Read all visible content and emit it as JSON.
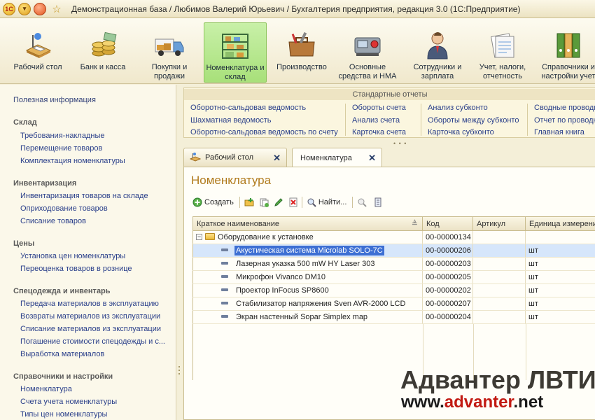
{
  "window": {
    "title": "Демонстрационная база / Любимов Валерий Юрьевич / Бухгалтерия предприятия, редакция 3.0  (1С:Предприятие)",
    "logo_text": "1С"
  },
  "sections": [
    {
      "label": "Рабочий стол",
      "icon": "desk-icon"
    },
    {
      "label": "Банк и касса",
      "icon": "coins-icon"
    },
    {
      "label": "Покупки и продажи",
      "icon": "truck-icon"
    },
    {
      "label": "Номенклатура и склад",
      "icon": "warehouse-icon",
      "active": true
    },
    {
      "label": "Производство",
      "icon": "toolbox-icon"
    },
    {
      "label": "Основные средства и НМА",
      "icon": "machine-icon"
    },
    {
      "label": "Сотрудники и зарплата",
      "icon": "employee-icon"
    },
    {
      "label": "Учет, налоги, отчетность",
      "icon": "documents-icon"
    },
    {
      "label": "Справочники и настройки учет",
      "icon": "binders-icon"
    }
  ],
  "sidebar": {
    "info": "Полезная информация",
    "groups": [
      {
        "title": "Склад",
        "items": [
          "Требования-накладные",
          "Перемещение товаров",
          "Комплектация номенклатуры"
        ]
      },
      {
        "title": "Инвентаризация",
        "items": [
          "Инвентаризация товаров на складе",
          "Оприходование товаров",
          "Списание товаров"
        ]
      },
      {
        "title": "Цены",
        "items": [
          "Установка цен номенклатуры",
          "Переоценка товаров в рознице"
        ]
      },
      {
        "title": "Спецодежда и инвентарь",
        "items": [
          "Передача материалов в эксплуатацию",
          "Возвраты материалов из эксплуатации",
          "Списание материалов из эксплуатации",
          "Погашение стоимости спецодежды и с...",
          "Выработка материалов"
        ]
      },
      {
        "title": "Справочники и настройки",
        "items": [
          "Номенклатура",
          "Счета учета номенклатуры",
          "Типы цен номенклатуры"
        ]
      }
    ]
  },
  "reports": {
    "title": "Стандартные отчеты",
    "columns": [
      [
        "Оборотно-сальдовая ведомость",
        "Шахматная ведомость",
        "Оборотно-сальдовая ведомость по счету"
      ],
      [
        "Обороты счета",
        "Анализ счета",
        "Карточка счета"
      ],
      [
        "Анализ субконто",
        "Обороты между субконто",
        "Карточка субконто"
      ],
      [
        "Сводные проводки",
        "Отчет по проводкам",
        "Главная книга"
      ]
    ]
  },
  "tabs": [
    {
      "label": "Рабочий стол"
    },
    {
      "label": "Номенклатура"
    }
  ],
  "form": {
    "title": "Номенклатура",
    "create_label": "Создать",
    "find_label": "Найти..."
  },
  "table": {
    "columns": [
      "Краткое наименование",
      "Код",
      "Артикул",
      "Единица измерения"
    ],
    "rows": [
      {
        "type": "folder",
        "name": "Оборудование к установке",
        "code": "00-00000134",
        "article": "",
        "unit": ""
      },
      {
        "type": "item",
        "name": "Акустическая система Microlab SOLO-7C",
        "code": "00-00000206",
        "article": "",
        "unit": "шт",
        "selected": true
      },
      {
        "type": "item",
        "name": "Лазерная указка 500 mW HY Laser 303",
        "code": "00-00000203",
        "article": "",
        "unit": "шт"
      },
      {
        "type": "item",
        "name": "Микрофон Vivanco DM10",
        "code": "00-00000205",
        "article": "",
        "unit": "шт"
      },
      {
        "type": "item",
        "name": "Проектор InFocus SP8600",
        "code": "00-00000202",
        "article": "",
        "unit": "шт"
      },
      {
        "type": "item",
        "name": "Стабилизатор напряжения Sven AVR-2000 LCD",
        "code": "00-00000207",
        "article": "",
        "unit": "шт"
      },
      {
        "type": "item",
        "name": "Экран настенный Sopar Simplex map",
        "code": "00-00000204",
        "article": "",
        "unit": "шт"
      }
    ]
  },
  "watermark": {
    "line1": "Адвантер ЛВТИ",
    "line2_a": "www.",
    "line2_b": "advanter",
    "line2_c": ".net"
  },
  "colors": {
    "accent_title": "#b07a1c",
    "link": "#2a3f8a",
    "active_section": "#a8e07a",
    "selection": "#3d6fd3"
  }
}
